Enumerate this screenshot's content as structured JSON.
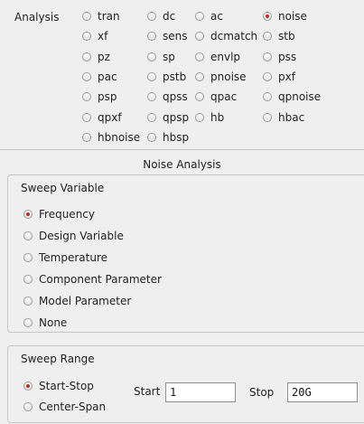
{
  "analysis": {
    "label": "Analysis",
    "selected": "noise",
    "options": [
      [
        "tran",
        "dc",
        "ac",
        "noise"
      ],
      [
        "xf",
        "sens",
        "dcmatch",
        "stb"
      ],
      [
        "pz",
        "sp",
        "envlp",
        "pss"
      ],
      [
        "pac",
        "pstb",
        "pnoise",
        "pxf"
      ],
      [
        "psp",
        "qpss",
        "qpac",
        "qpnoise"
      ],
      [
        "qpxf",
        "qpsp",
        "hb",
        "hbac"
      ],
      [
        "hbnoise",
        "hbsp"
      ]
    ]
  },
  "section_title": "Noise Analysis",
  "sweep_variable": {
    "title": "Sweep Variable",
    "selected": "Frequency",
    "options": [
      "Frequency",
      "Design Variable",
      "Temperature",
      "Component Parameter",
      "Model Parameter",
      "None"
    ]
  },
  "sweep_range": {
    "title": "Sweep Range",
    "selected": "Start-Stop",
    "options": [
      "Start-Stop",
      "Center-Span"
    ],
    "start_label": "Start",
    "start_value": "1",
    "stop_label": "Stop",
    "stop_value": "20G"
  },
  "colors": {
    "selected_dot": "#d42020",
    "background": "#efefef"
  }
}
